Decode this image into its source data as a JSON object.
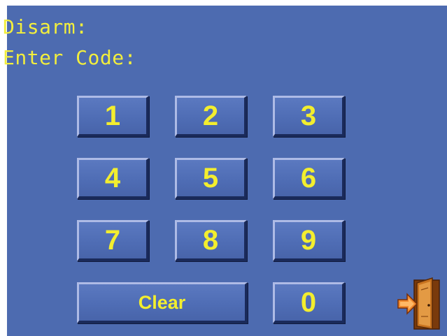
{
  "prompt": {
    "line1": "Disarm:",
    "line2": "Enter Code:"
  },
  "keypad": {
    "k1": "1",
    "k2": "2",
    "k3": "3",
    "k4": "4",
    "k5": "5",
    "k6": "6",
    "k7": "7",
    "k8": "8",
    "k9": "9",
    "k0": "0",
    "clear": "Clear"
  },
  "icons": {
    "exit": "exit-door-icon"
  },
  "colors": {
    "background": "#4d6bb0",
    "text": "#f2ee3d",
    "door": "#b5651d",
    "arrow": "#e8732c"
  }
}
